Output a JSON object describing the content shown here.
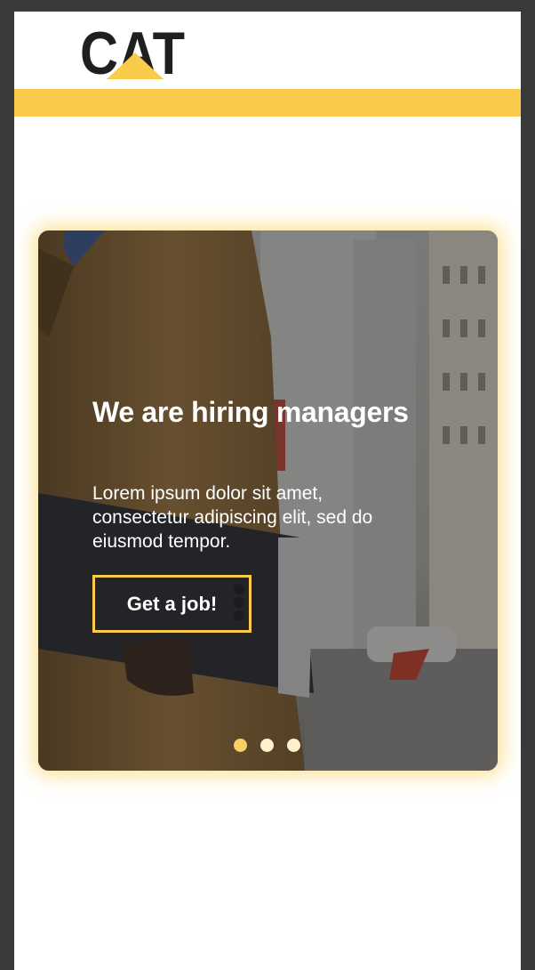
{
  "brand": {
    "logo_text": "CAT",
    "accent_color": "#f8cc4a"
  },
  "hero": {
    "title": "We are hiring managers",
    "body": "Lorem ipsum dolor sit amet, consectetur adipiscing elit, sed do eiusmod tempor.",
    "cta_label": "Get a job!"
  },
  "carousel": {
    "slide_count": 3,
    "active_index": 0
  }
}
